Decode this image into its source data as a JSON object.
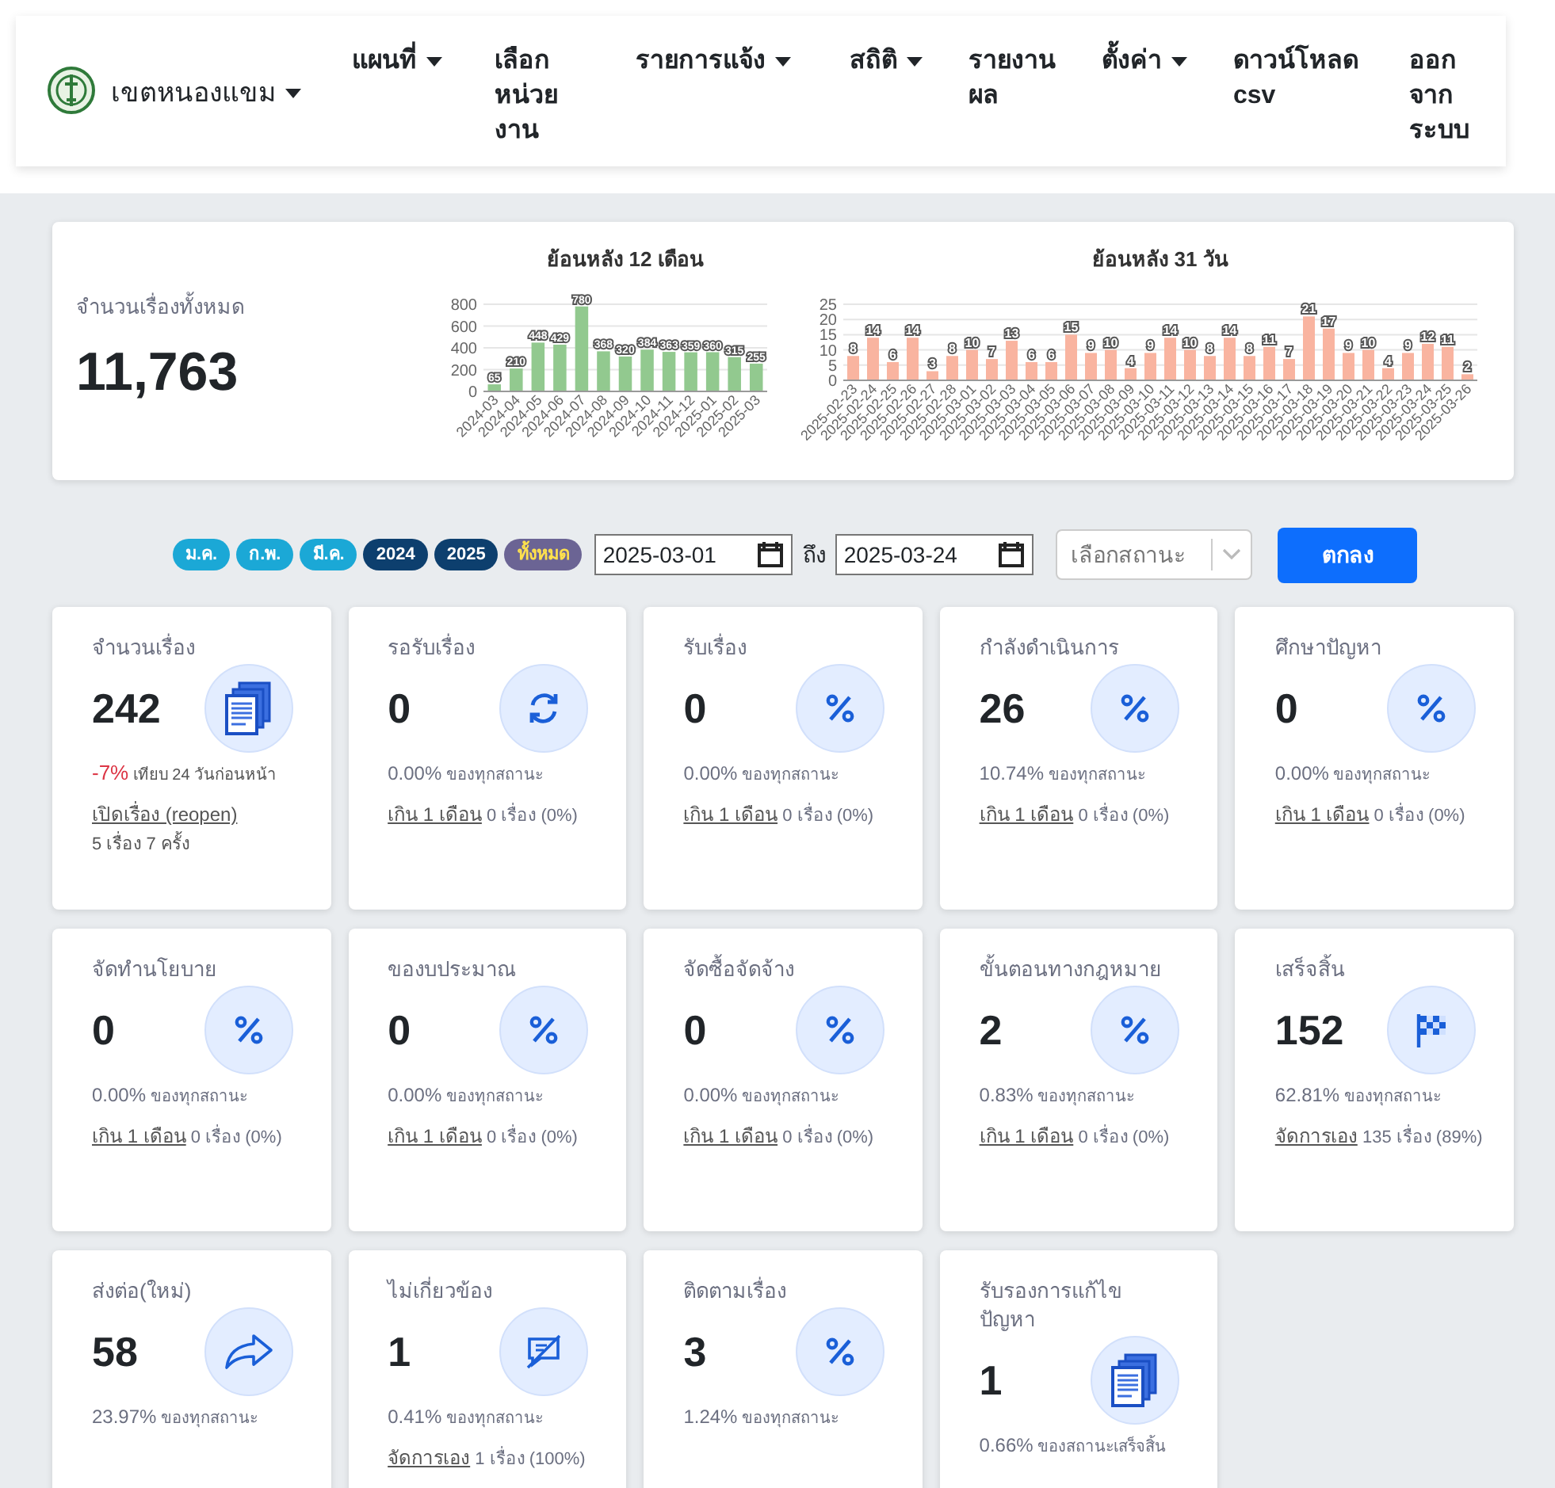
{
  "navbar": {
    "district": "เขตหนองแขม",
    "menu": [
      {
        "label": "แผนที่",
        "dropdown": true
      },
      {
        "label": "เลือกหน่วยงาน",
        "dropdown": false
      },
      {
        "label": "รายการแจ้ง",
        "dropdown": true
      },
      {
        "label": "สถิติ",
        "dropdown": true
      },
      {
        "label": "รายงานผล",
        "dropdown": false
      },
      {
        "label": "ตั้งค่า",
        "dropdown": true
      },
      {
        "label": "ดาวน์โหลด csv",
        "dropdown": false
      },
      {
        "label": "ออกจากระบบ",
        "dropdown": false
      }
    ]
  },
  "summary": {
    "label": "จำนวนเรื่องทั้งหมด",
    "total": "11,763",
    "charts": [
      {
        "chart_data": {
          "type": "bar",
          "title": "ย้อนหลัง 12 เดือน",
          "categories": [
            "2024-03",
            "2024-04",
            "2024-05",
            "2024-06",
            "2024-07",
            "2024-08",
            "2024-09",
            "2024-10",
            "2024-11",
            "2024-12",
            "2025-01",
            "2025-02",
            "2025-03"
          ],
          "series": [
            {
              "color": "#92c98f",
              "values": [
                65,
                210,
                448,
                429,
                780,
                368,
                320,
                384,
                363,
                359,
                360,
                315,
                255
              ]
            }
          ],
          "ylim": [
            0,
            800
          ],
          "yticks": [
            0,
            200,
            400,
            600,
            800
          ],
          "grid": true,
          "data_labels": true
        }
      },
      {
        "chart_data": {
          "type": "bar",
          "title": "ย้อนหลัง 31 วัน",
          "categories": [
            "2025-02-23",
            "2025-02-24",
            "2025-02-25",
            "2025-02-26",
            "2025-02-27",
            "2025-02-28",
            "2025-03-01",
            "2025-03-02",
            "2025-03-03",
            "2025-03-04",
            "2025-03-05",
            "2025-03-06",
            "2025-03-07",
            "2025-03-08",
            "2025-03-09",
            "2025-03-10",
            "2025-03-11",
            "2025-03-12",
            "2025-03-13",
            "2025-03-14",
            "2025-03-15",
            "2025-03-16",
            "2025-03-17",
            "2025-03-18",
            "2025-03-19",
            "2025-03-20",
            "2025-03-21",
            "2025-03-22",
            "2025-03-23",
            "2025-03-24",
            "2025-03-25",
            "2025-03-26"
          ],
          "series": [
            {
              "color": "#f9b4a0",
              "values": [
                8,
                14,
                6,
                14,
                3,
                8,
                10,
                7,
                13,
                6,
                6,
                15,
                9,
                10,
                4,
                9,
                14,
                10,
                8,
                14,
                8,
                11,
                7,
                21,
                17,
                9,
                10,
                4,
                9,
                12,
                11,
                2
              ]
            }
          ],
          "ylim": [
            0,
            25
          ],
          "yticks": [
            0,
            5,
            10,
            15,
            20,
            25
          ],
          "grid": true,
          "data_labels": true
        }
      }
    ]
  },
  "filters": {
    "chips": [
      {
        "label": "ม.ค.",
        "kind": "month"
      },
      {
        "label": "ก.พ.",
        "kind": "month"
      },
      {
        "label": "มี.ค.",
        "kind": "month"
      },
      {
        "label": "2024",
        "kind": "year"
      },
      {
        "label": "2025",
        "kind": "year"
      },
      {
        "label": "ทั้งหมด",
        "kind": "all"
      }
    ],
    "date_from": "2025-03-01",
    "to_label": "ถึง",
    "date_to": "2025-03-24",
    "status_placeholder": "เลือกสถานะ",
    "submit": "ตกลง"
  },
  "cards": [
    {
      "title": "จำนวนเรื่อง",
      "value": "242",
      "kind": "documents",
      "change": "-7%",
      "change_note": "เทียบ 24 วันก่อนหน้า",
      "link": "เปิดเรื่อง (reopen)",
      "note": "5 เรื่อง 7 ครั้ง"
    },
    {
      "title": "รอรับเรื่อง",
      "value": "0",
      "kind": "refresh",
      "percent": "0.00%",
      "percent_note": "ของทุกสถานะ",
      "link": "เกิน 1 เดือน",
      "link_note": "0 เรื่อง (0%)"
    },
    {
      "title": "รับเรื่อง",
      "value": "0",
      "kind": "percent",
      "percent": "0.00%",
      "percent_note": "ของทุกสถานะ",
      "link": "เกิน 1 เดือน",
      "link_note": "0 เรื่อง (0%)"
    },
    {
      "title": "กำลังดำเนินการ",
      "value": "26",
      "kind": "percent",
      "percent": "10.74%",
      "percent_note": "ของทุกสถานะ",
      "link": "เกิน 1 เดือน",
      "link_note": "0 เรื่อง (0%)"
    },
    {
      "title": "ศึกษาปัญหา",
      "value": "0",
      "kind": "percent",
      "percent": "0.00%",
      "percent_note": "ของทุกสถานะ",
      "link": "เกิน 1 เดือน",
      "link_note": "0 เรื่อง (0%)"
    },
    {
      "title": "จัดทำนโยบาย",
      "value": "0",
      "kind": "percent",
      "percent": "0.00%",
      "percent_note": "ของทุกสถานะ",
      "link": "เกิน 1 เดือน",
      "link_note": "0 เรื่อง (0%)"
    },
    {
      "title": "ของบประมาณ",
      "value": "0",
      "kind": "percent",
      "percent": "0.00%",
      "percent_note": "ของทุกสถานะ",
      "link": "เกิน 1 เดือน",
      "link_note": "0 เรื่อง (0%)"
    },
    {
      "title": "จัดซื้อจัดจ้าง",
      "value": "0",
      "kind": "percent",
      "percent": "0.00%",
      "percent_note": "ของทุกสถานะ",
      "link": "เกิน 1 เดือน",
      "link_note": "0 เรื่อง (0%)"
    },
    {
      "title": "ขั้นตอนทางกฎหมาย",
      "value": "2",
      "kind": "percent",
      "percent": "0.83%",
      "percent_note": "ของทุกสถานะ",
      "link": "เกิน 1 เดือน",
      "link_note": "0 เรื่อง (0%)"
    },
    {
      "title": "เสร็จสิ้น",
      "value": "152",
      "kind": "finished",
      "percent": "62.81%",
      "percent_note": "ของทุกสถานะ",
      "link": "จัดการเอง",
      "link_note": "135 เรื่อง (89%)"
    },
    {
      "title": "ส่งต่อ(ใหม่)",
      "value": "58",
      "kind": "forwarded",
      "percent": "23.97%",
      "percent_note": "ของทุกสถานะ"
    },
    {
      "title": "ไม่เกี่ยวข้อง",
      "value": "1",
      "kind": "unrelated",
      "percent": "0.41%",
      "percent_note": "ของทุกสถานะ",
      "link": "จัดการเอง",
      "link_note": "1 เรื่อง (100%)"
    },
    {
      "title": "ติดตามเรื่อง",
      "value": "3",
      "kind": "percent",
      "percent": "1.24%",
      "percent_note": "ของทุกสถานะ"
    },
    {
      "title": "รับรองการแก้ไขปัญหา",
      "value": "1",
      "kind": "documents",
      "percent": "0.66%",
      "percent_note": "ของสถานะเสร็จสิ้น"
    }
  ]
}
